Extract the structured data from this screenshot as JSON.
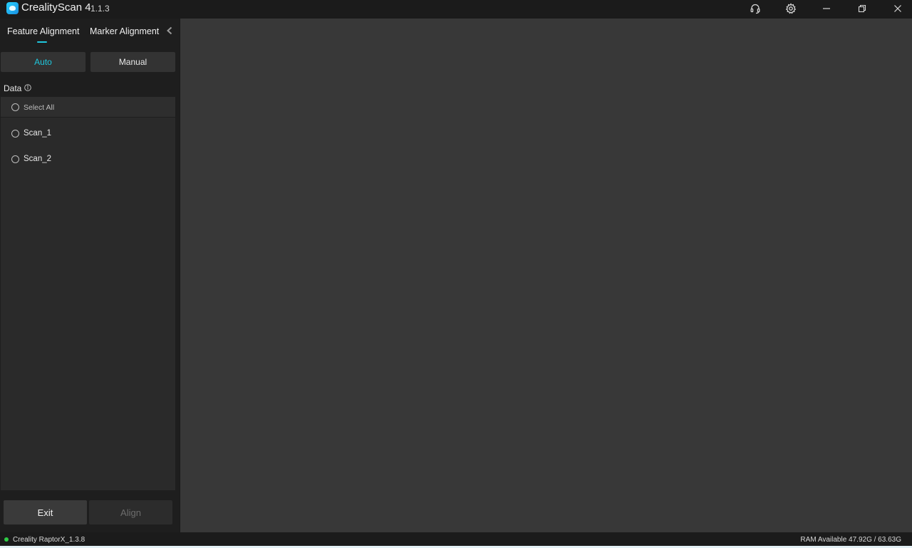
{
  "window": {
    "app_name": "CrealityScan 4",
    "version": "1.1.3",
    "icons": [
      "headset-icon",
      "gear-icon",
      "minimize-icon",
      "restore-icon",
      "close-icon"
    ]
  },
  "sidebar": {
    "tabs": [
      {
        "label": "Feature Alignment",
        "active": true
      },
      {
        "label": "Marker Alignment",
        "active": false
      }
    ],
    "modes": [
      {
        "label": "Auto",
        "active": true
      },
      {
        "label": "Manual",
        "active": false
      }
    ],
    "data_label": "Data",
    "select_all_label": "Select All",
    "items": [
      {
        "label": "Scan_1",
        "checked": false
      },
      {
        "label": "Scan_2",
        "checked": false
      }
    ],
    "exit_label": "Exit",
    "align_label": "Align"
  },
  "status": {
    "device": "Creality RaptorX_1.3.8",
    "ram": "RAM Available 47.92G / 63.63G"
  },
  "colors": {
    "accent": "#1fc8de",
    "connected": "#2fcc45",
    "viewport": "#383838"
  }
}
